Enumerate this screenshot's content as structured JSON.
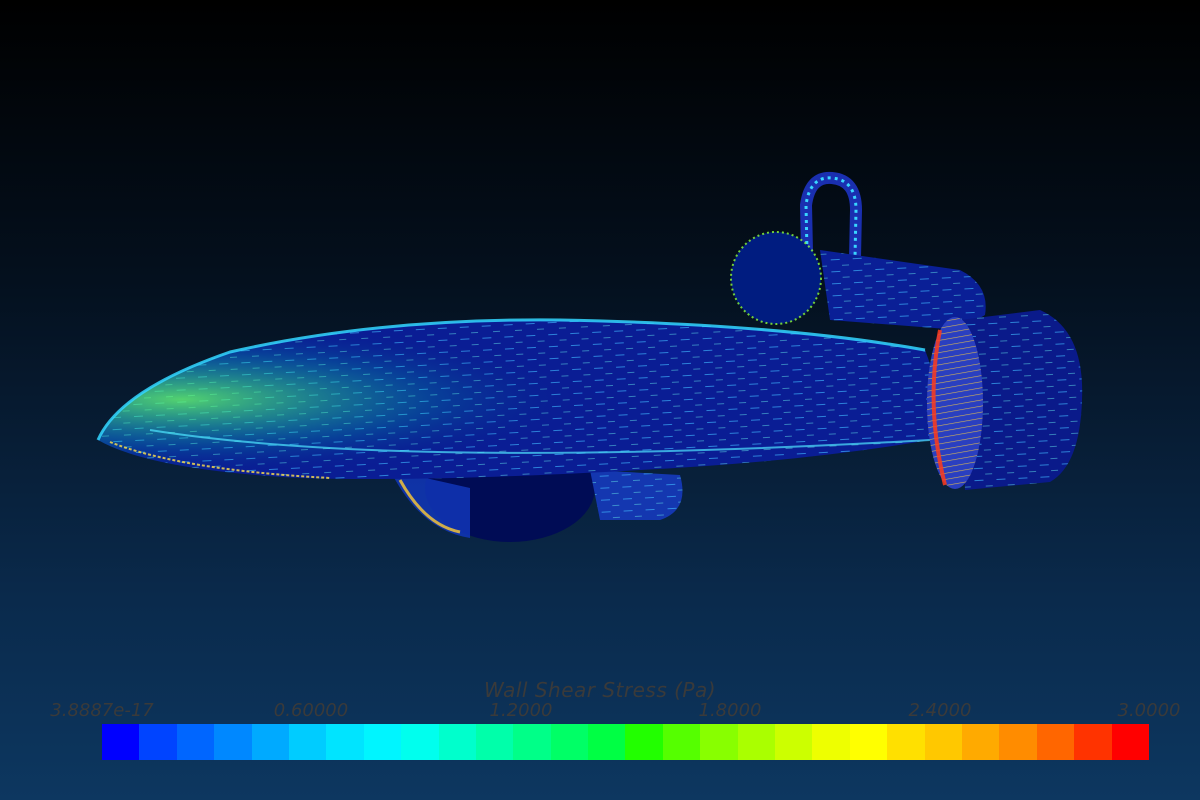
{
  "colorbar": {
    "title": "Wall Shear Stress (Pa)",
    "ticks": [
      "3.8887e-17",
      "0.60000",
      "1.2000",
      "1.8000",
      "2.4000",
      "3.0000"
    ],
    "colors": [
      "#0000ff",
      "#0044ff",
      "#0066ff",
      "#0088ff",
      "#00aaff",
      "#00ccff",
      "#00e4ff",
      "#00f5ff",
      "#00ffee",
      "#00ffcc",
      "#00ffaa",
      "#00ff88",
      "#00ff66",
      "#00ff44",
      "#22ff00",
      "#55ff00",
      "#88ff00",
      "#aaff00",
      "#ccff00",
      "#eeff00",
      "#ffff00",
      "#ffe000",
      "#ffc800",
      "#ffaa00",
      "#ff8c00",
      "#ff6600",
      "#ff3300",
      "#ff0000"
    ]
  },
  "scene": {
    "model": "race car body with wall shear stress vectors",
    "colors": {
      "body": "#001f8c",
      "low": "#0000ff",
      "mid": "#00ffcc",
      "high": "#ff0000"
    }
  }
}
